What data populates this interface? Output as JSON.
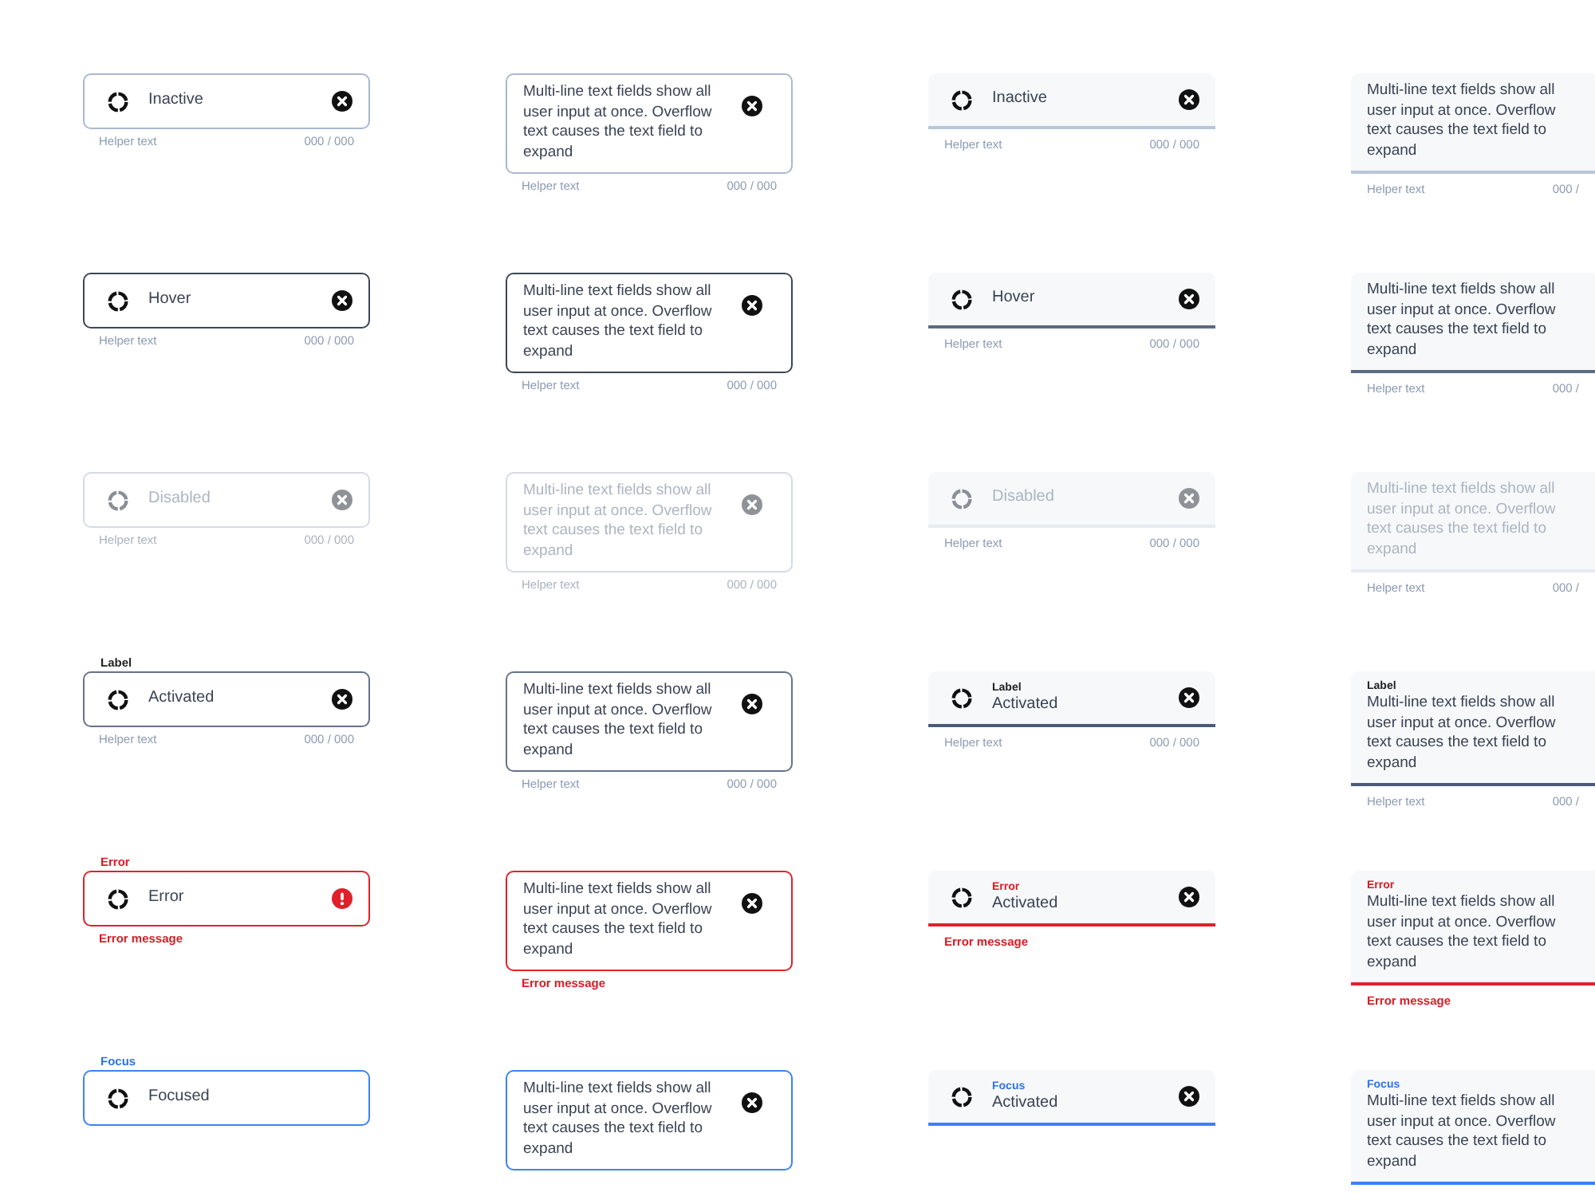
{
  "columns": [
    {
      "kind": "outlined",
      "multiline": false,
      "fields": [
        {
          "kind": "inactive",
          "value": "Inactive",
          "clear_button": true,
          "helper": "Helper text",
          "counter": "000 / 000"
        },
        {
          "kind": "hover",
          "value": "Hover",
          "clear_button": true,
          "helper": "Helper text",
          "counter": "000 / 000"
        },
        {
          "kind": "disabled",
          "value": "Disabled",
          "clear_button": true,
          "helper": "Helper text",
          "counter": "000 / 000"
        },
        {
          "kind": "activated",
          "label": "Label",
          "value": "Activated",
          "clear_button": true,
          "helper": "Helper text",
          "counter": "000 / 000"
        },
        {
          "kind": "error",
          "label": "Error",
          "value": "Error",
          "alert_icon": true,
          "helper": "Error message"
        },
        {
          "kind": "focused",
          "label": "Focus",
          "value": "Focused"
        }
      ]
    },
    {
      "kind": "outlined",
      "multiline": true,
      "fields": [
        {
          "kind": "inactive",
          "value": "Multi-line text fields show all user input at once. Overflow text causes the text field to expand",
          "clear_button": true,
          "helper": "Helper text",
          "counter": "000 / 000"
        },
        {
          "kind": "hover",
          "value": "Multi-line text fields show all user input at once. Overflow text causes the text field to expand",
          "clear_button": true,
          "helper": "Helper text",
          "counter": "000 / 000"
        },
        {
          "kind": "disabled",
          "value": "Multi-line text fields show all user input at once. Overflow text causes the text field to expand",
          "clear_button": true,
          "helper": "Helper text",
          "counter": "000 / 000"
        },
        {
          "kind": "activated",
          "value": "Multi-line text fields show all user input at once. Overflow text causes the text field to expand",
          "clear_button": true,
          "helper": "Helper text",
          "counter": "000 / 000"
        },
        {
          "kind": "error",
          "value": "Multi-line text fields show all user input at once. Overflow text causes the text field to expand",
          "clear_button": true,
          "helper": "Error message"
        },
        {
          "kind": "focused",
          "value": "Multi-line text fields show all user input at once. Overflow text causes the text field to expand",
          "clear_button": true
        }
      ]
    },
    {
      "kind": "filled",
      "multiline": false,
      "fields": [
        {
          "kind": "inactive",
          "value": "Inactive",
          "clear_button": true,
          "helper": "Helper text",
          "counter": "000 / 000"
        },
        {
          "kind": "hover",
          "value": "Hover",
          "clear_button": true,
          "helper": "Helper text",
          "counter": "000 / 000"
        },
        {
          "kind": "disabled",
          "value": "Disabled",
          "clear_button": true,
          "helper": "Helper text",
          "counter": "000 / 000"
        },
        {
          "kind": "activated",
          "label": "Label",
          "value": "Activated",
          "clear_button": true,
          "helper": "Helper text",
          "counter": "000 / 000"
        },
        {
          "kind": "error",
          "label": "Error",
          "value": "Activated",
          "clear_button": true,
          "helper": "Error message"
        },
        {
          "kind": "focused",
          "label": "Focus",
          "value": "Activated",
          "clear_button": true
        }
      ]
    },
    {
      "kind": "filled",
      "multiline": true,
      "fields": [
        {
          "kind": "inactive",
          "value": "Multi-line text fields show all user input at once. Overflow text causes the text field to expand",
          "helper": "Helper text",
          "counter": "000 /"
        },
        {
          "kind": "hover",
          "value": "Multi-line text fields show all user input at once. Overflow text causes the text field to expand",
          "helper": "Helper text",
          "counter": "000 /"
        },
        {
          "kind": "disabled",
          "value": "Multi-line text fields show all user input at once. Overflow text causes the text field to expand",
          "helper": "Helper text",
          "counter": "000 /"
        },
        {
          "kind": "activated",
          "label": "Label",
          "value": "Multi-line text fields show all user input at once. Overflow text causes the text field to expand",
          "helper": "Helper text",
          "counter": "000 /"
        },
        {
          "kind": "error",
          "label": "Error",
          "value": "Multi-line text fields show all user input at once. Overflow text causes the text field to expand",
          "helper": "Error message"
        },
        {
          "kind": "focused",
          "label": "Focus",
          "value": "Multi-line text fields show all user input at once. Overflow text causes the text field to expand"
        }
      ]
    }
  ]
}
